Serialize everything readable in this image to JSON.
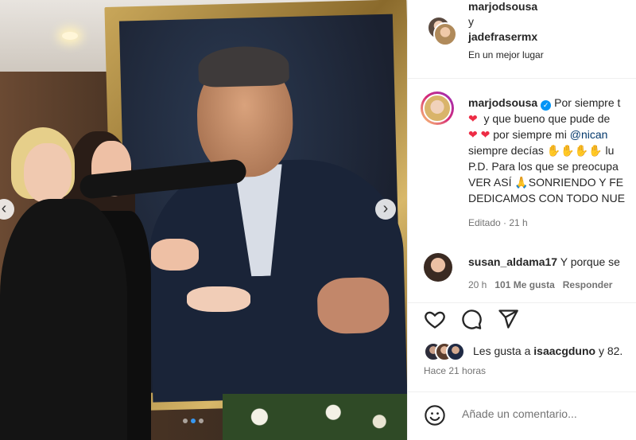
{
  "collab": {
    "user1": "marjodsousa",
    "joiner": "y",
    "user2": "jadefrasermx",
    "location": "En un mejor lugar"
  },
  "caption": {
    "username": "marjodsousa",
    "line1": "Por siempre t",
    "line2": "y que bueno que pude de",
    "line3_prefix": "por siempre mi",
    "line3_mention": "@nican",
    "line4_prefix": "siempre decías",
    "line4_suffix": "lu",
    "line5": "P.D. Para los que se preocupa",
    "line6": "VER ASÍ",
    "line6_suffix": "SONRIENDO Y FE",
    "line7": "DEDICAMOS CON TODO NUE",
    "meta": "Editado · 21 h"
  },
  "comment2": {
    "username": "susan_aldama17",
    "text": "Y porque se",
    "time": "20 h",
    "likes": "101 Me gusta",
    "reply": "Responder"
  },
  "likes": {
    "prefix": "Les gusta a",
    "user": "isaacgduno",
    "suffix": "y 82."
  },
  "posted": "Hace 21 horas",
  "add_comment_placeholder": "Añade un comentario...",
  "icons": {
    "like": "heart-outline-icon",
    "comment": "comment-bubble-icon",
    "share": "paper-plane-icon",
    "emoji": "emoji-icon"
  },
  "colors": {
    "verified": "#0095f6",
    "heart": "#ed2c45",
    "carousel_active": "#3797f0"
  }
}
